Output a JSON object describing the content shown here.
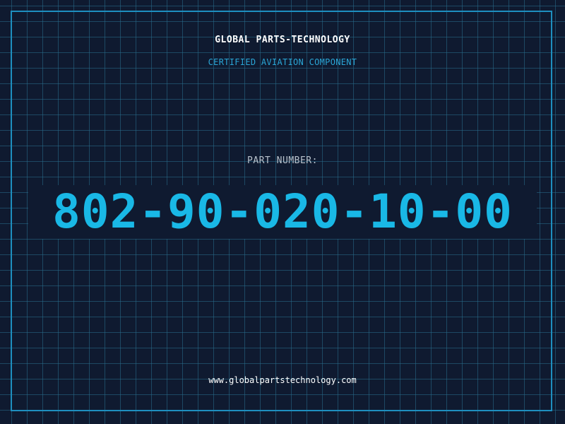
{
  "header": {
    "company": "GLOBAL PARTS-TECHNOLOGY",
    "subtitle": "CERTIFIED AVIATION COMPONENT"
  },
  "part": {
    "label": "PART NUMBER:",
    "number": "802-90-020-10-00"
  },
  "footer": {
    "url": "www.globalpartstechnology.com"
  },
  "colors": {
    "background": "#0f1a30",
    "grid": "#286e8c",
    "frame": "#1e8fbf",
    "accent": "#19b8e6",
    "subtitle": "#2aa6d6"
  }
}
